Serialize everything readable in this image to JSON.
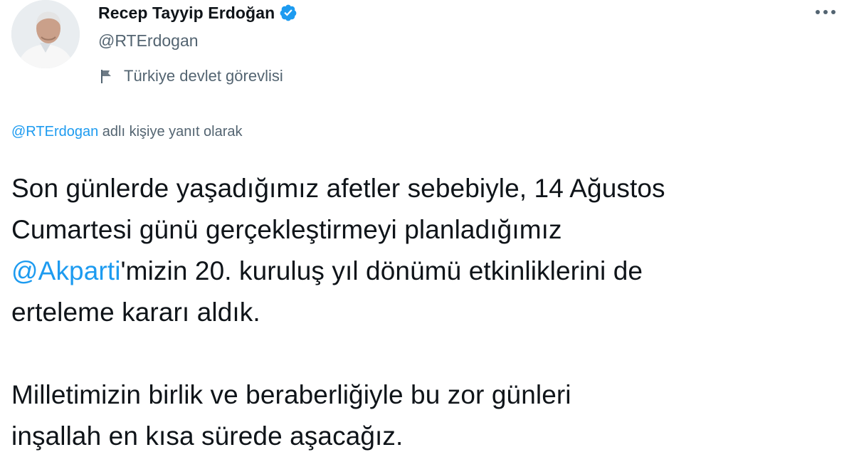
{
  "author": {
    "name": "Recep Tayyip Erdoğan",
    "handle": "@RTErdogan",
    "label": "Türkiye devlet görevlisi"
  },
  "reply": {
    "mention": "@RTErdogan",
    "text": " adlı kişiye yanıt olarak"
  },
  "tweet": {
    "p1_lines": [
      "Son günlerde yaşadığımız afetler sebebiyle, 14 Ağustos",
      "Cumartesi günü gerçekleştirmeyi planladığımız"
    ],
    "p1_mention": "@Akparti",
    "p1_after_mention": "'mizin 20. kuruluş yıl dönümü etkinliklerini de",
    "p1_last": "erteleme kararı aldık.",
    "p2_lines": [
      "Milletimizin birlik ve beraberliğiyle bu zor günleri",
      "inşallah en kısa sürede aşacağız."
    ]
  },
  "colors": {
    "accent": "#1d9bf0",
    "text": "#0f1419",
    "secondary": "#536471"
  },
  "icons": {
    "verified": "verified-badge-icon",
    "label": "government-flag-icon",
    "menu": "more-options-icon"
  }
}
